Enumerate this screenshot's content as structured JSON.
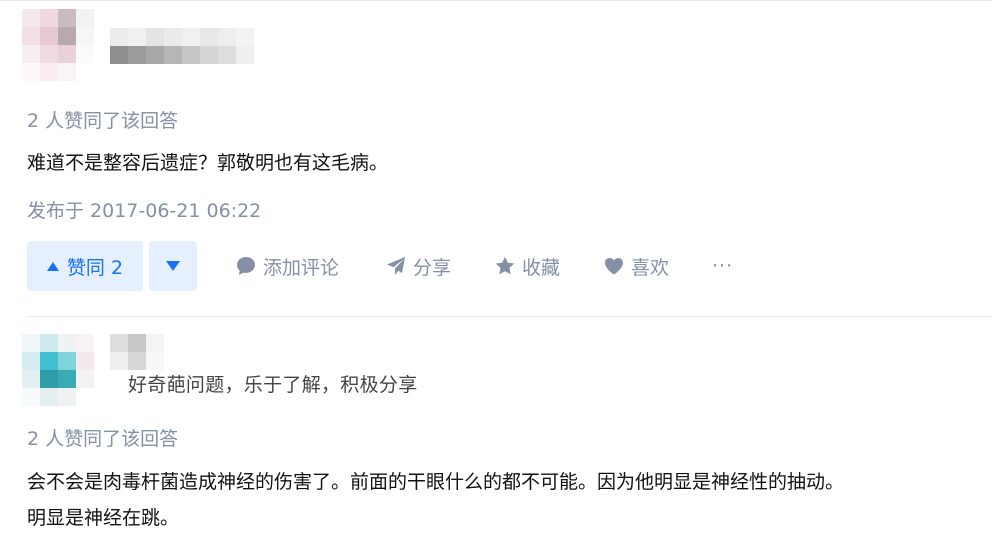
{
  "answer1": {
    "voters": "2 人赞同了该回答",
    "content": "难道不是整容后遗症？郭敬明也有这毛病。",
    "published": "发布于 2017-06-21 06:22",
    "actions": {
      "upvote_label": "赞同 2",
      "comment_label": "添加评论",
      "share_label": "分享",
      "collect_label": "收藏",
      "like_label": "喜欢",
      "more_label": "···"
    }
  },
  "answer2": {
    "headline": "好奇葩问题，乐于了解，积极分享",
    "voters": "2 人赞同了该回答",
    "content_line1": "会不会是肉毒杆菌造成神经的伤害了。前面的干眼什么的都不可能。因为他明显是神经性的抽动。",
    "content_line2": "明显是神经在跳。"
  },
  "colors": {
    "accent": "#1772f6",
    "vote_bg": "#e5effd",
    "meta": "#8590a6"
  },
  "icons": {
    "upvote": "triangle-up-icon",
    "downvote": "triangle-down-icon",
    "comment": "speech-bubble-icon",
    "share": "paper-plane-icon",
    "collect": "star-icon",
    "like": "heart-icon"
  }
}
